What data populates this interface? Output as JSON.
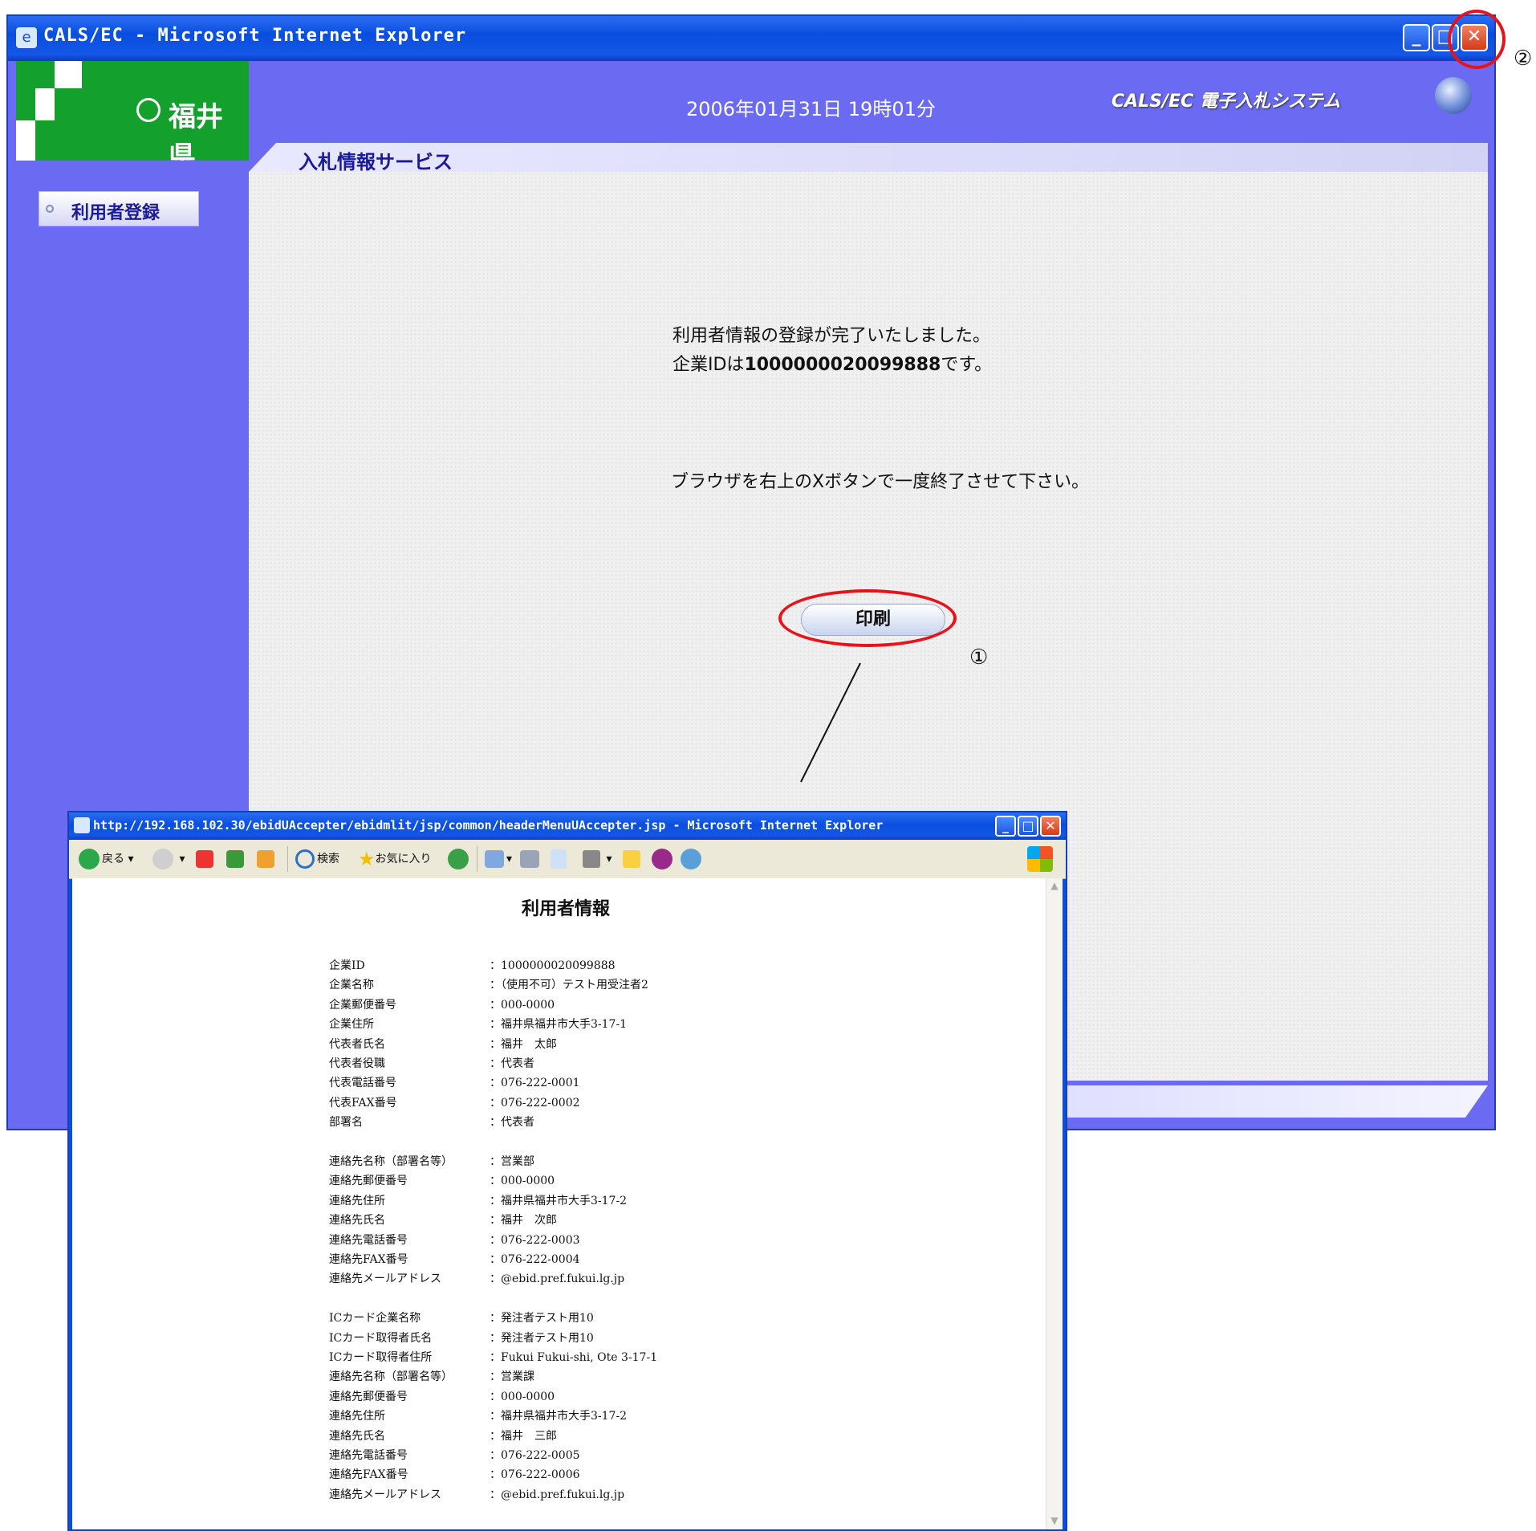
{
  "main_window": {
    "title": "CALS/EC - Microsoft Internet Explorer",
    "logo_text": "福井県",
    "datetime": "2006年01月31日 19時01分",
    "system_name": "CALS/EC 電子入札システム",
    "section_title": "入札情報サービス",
    "sidebar": {
      "items": [
        {
          "label": "利用者登録"
        }
      ]
    },
    "message_line1": "利用者情報の登録が完了いたしました。",
    "message_line2_prefix": "企業IDは",
    "message_line2_id": "1000000020099888",
    "message_line2_suffix": "です。",
    "message_line3": "ブラウザを右上のXボタンで一度終了させて下さい。",
    "print_button": "印刷",
    "annotation_1": "①",
    "annotation_2": "②"
  },
  "popup_window": {
    "title": "http://192.168.102.30/ebidUAccepter/ebidmlit/jsp/common/headerMenuUAccepter.jsp - Microsoft Internet Explorer",
    "toolbar": {
      "back": "戻る",
      "search": "検索",
      "favorites": "お気に入り"
    },
    "doc_title": "利用者情報",
    "rows": [
      {
        "label": "企業ID",
        "value": "1000000020099888"
      },
      {
        "label": "企業名称",
        "value": "（使用不可）テスト用受注者2"
      },
      {
        "label": "企業郵便番号",
        "value": "000-0000"
      },
      {
        "label": "企業住所",
        "value": "福井県福井市大手3-17-1"
      },
      {
        "label": "代表者氏名",
        "value": "福井　太郎"
      },
      {
        "label": "代表者役職",
        "value": "代表者"
      },
      {
        "label": "代表電話番号",
        "value": "076-222-0001"
      },
      {
        "label": "代表FAX番号",
        "value": "076-222-0002"
      },
      {
        "label": "部署名",
        "value": "代表者"
      },
      {
        "label": "連絡先名称（部署名等）",
        "value": "営業部"
      },
      {
        "label": "連絡先郵便番号",
        "value": "000-0000"
      },
      {
        "label": "連絡先住所",
        "value": "福井県福井市大手3-17-2"
      },
      {
        "label": "連絡先氏名",
        "value": "福井　次郎"
      },
      {
        "label": "連絡先電話番号",
        "value": "076-222-0003"
      },
      {
        "label": "連絡先FAX番号",
        "value": "076-222-0004"
      },
      {
        "label": "連絡先メールアドレス",
        "value": "@ebid.pref.fukui.lg.jp"
      },
      {
        "label": "ICカード企業名称",
        "value": "発注者テスト用10"
      },
      {
        "label": "ICカード取得者氏名",
        "value": "発注者テスト用10"
      },
      {
        "label": "ICカード取得者住所",
        "value": "Fukui Fukui-shi, Ote 3-17-1"
      },
      {
        "label": "連絡先名称（部署名等）",
        "value": "営業課"
      },
      {
        "label": "連絡先郵便番号",
        "value": "000-0000"
      },
      {
        "label": "連絡先住所",
        "value": "福井県福井市大手3-17-2"
      },
      {
        "label": "連絡先氏名",
        "value": "福井　三郎"
      },
      {
        "label": "連絡先電話番号",
        "value": "076-222-0005"
      },
      {
        "label": "連絡先FAX番号",
        "value": "076-222-0006"
      },
      {
        "label": "連絡先メールアドレス",
        "value": "@ebid.pref.fukui.lg.jp"
      }
    ]
  }
}
